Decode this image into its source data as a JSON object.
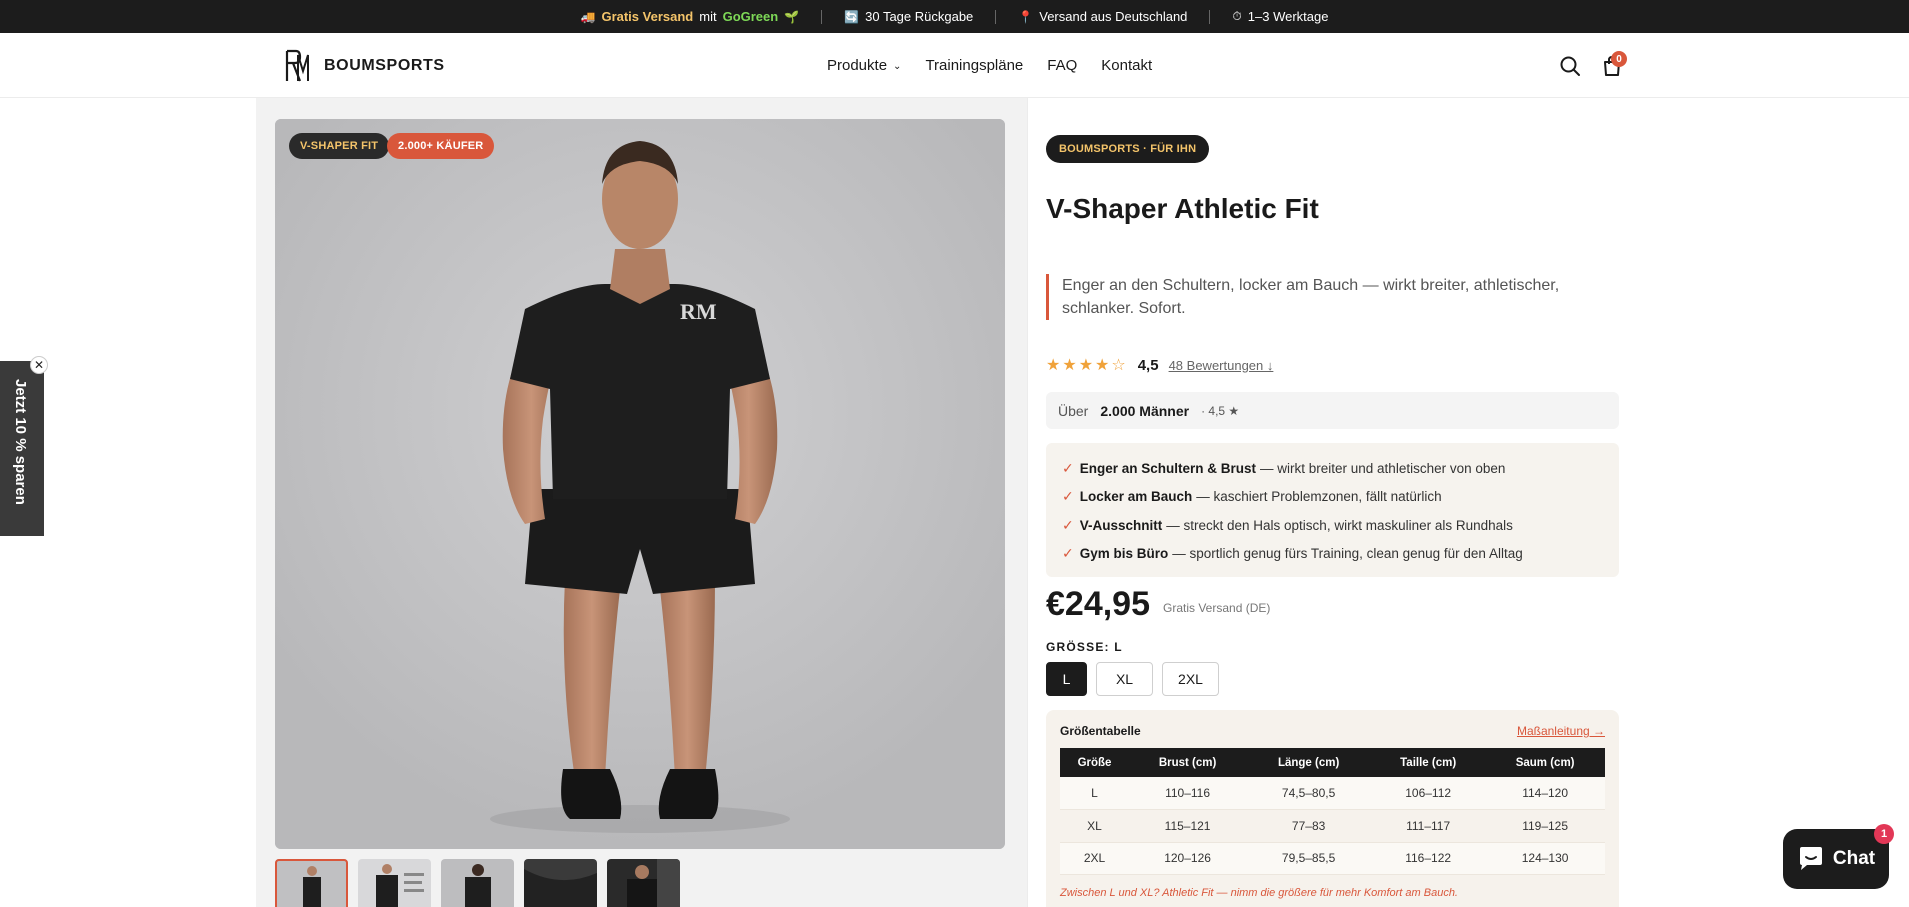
{
  "announcement": {
    "shipping_bold": "Gratis Versand",
    "shipping_mid": "mit",
    "shipping_green": "GoGreen",
    "returns": "30 Tage Rückgabe",
    "ship_from": "Versand aus Deutschland",
    "delivery": "1–3 Werktage"
  },
  "header": {
    "brand": "BOUMSPORTS",
    "nav": [
      "Produkte",
      "Trainingspläne",
      "FAQ",
      "Kontakt"
    ],
    "cart_count": "0"
  },
  "gallery": {
    "badge_fit": "V-SHAPER FIT",
    "badge_buyers": "2.000+ KÄUFER",
    "thumbnails": 5
  },
  "product": {
    "brand_pill": "BOUMSPORTS · FÜR IHN",
    "title": "V-Shaper Athletic Fit",
    "tagline": "Enger an den Schultern, locker am Bauch — wirkt breiter, athletischer, schlanker. Sofort.",
    "stars": "★★★★☆",
    "rating": "4,5",
    "reviews_link": "48 Bewertungen ↓",
    "social_prefix": "Über",
    "social_bold": "2.000 Männer",
    "social_suffix": "· 4,5 ★",
    "benefits": [
      {
        "bold": "Enger an Schultern & Brust",
        "text": "— wirkt breiter und athletischer von oben"
      },
      {
        "bold": "Locker am Bauch",
        "text": "— kaschiert Problemzonen, fällt natürlich"
      },
      {
        "bold": "V-Ausschnitt",
        "text": "— streckt den Hals optisch, wirkt maskuliner als Rundhals"
      },
      {
        "bold": "Gym bis Büro",
        "text": "— sportlich genug fürs Training, clean genug für den Alltag"
      }
    ],
    "price": "€24,95",
    "price_note": "Gratis Versand (DE)",
    "size_label": "GRÖSSE: L",
    "sizes": [
      "L",
      "XL",
      "2XL"
    ],
    "selected_size": "L"
  },
  "size_table": {
    "title": "Größentabelle",
    "guide_link": "Maßanleitung →",
    "headers": [
      "Größe",
      "Brust (cm)",
      "Länge (cm)",
      "Taille (cm)",
      "Saum (cm)"
    ],
    "rows": [
      [
        "L",
        "110–116",
        "74,5–80,5",
        "106–112",
        "114–120"
      ],
      [
        "XL",
        "115–121",
        "77–83",
        "111–117",
        "119–125"
      ],
      [
        "2XL",
        "120–126",
        "79,5–85,5",
        "116–122",
        "124–130"
      ]
    ],
    "note": "Zwischen L und XL? Athletic Fit — nimm die größere für mehr Komfort am Bauch."
  },
  "side_tab": {
    "label": "Jetzt 10 % sparen",
    "close": "✕"
  },
  "chat": {
    "label": "Chat",
    "badge": "1"
  },
  "colors": {
    "accent": "#d9573b",
    "dark": "#1c1c1c",
    "gold": "#f4c46a",
    "green": "#7ed957"
  }
}
